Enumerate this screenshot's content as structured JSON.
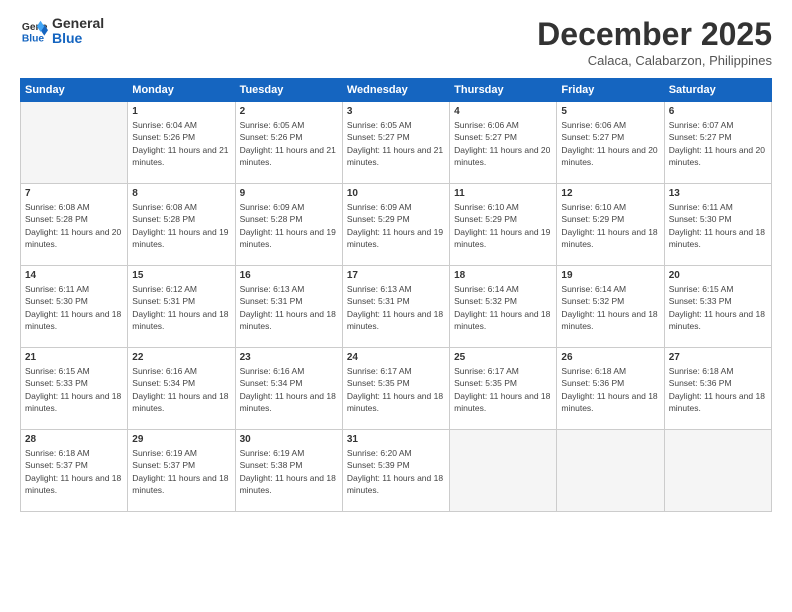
{
  "header": {
    "logo_general": "General",
    "logo_blue": "Blue",
    "month_title": "December 2025",
    "location": "Calaca, Calabarzon, Philippines"
  },
  "weekdays": [
    "Sunday",
    "Monday",
    "Tuesday",
    "Wednesday",
    "Thursday",
    "Friday",
    "Saturday"
  ],
  "weeks": [
    [
      {
        "day": "",
        "sunrise": "",
        "sunset": "",
        "daylight": ""
      },
      {
        "day": "1",
        "sunrise": "Sunrise: 6:04 AM",
        "sunset": "Sunset: 5:26 PM",
        "daylight": "Daylight: 11 hours and 21 minutes."
      },
      {
        "day": "2",
        "sunrise": "Sunrise: 6:05 AM",
        "sunset": "Sunset: 5:26 PM",
        "daylight": "Daylight: 11 hours and 21 minutes."
      },
      {
        "day": "3",
        "sunrise": "Sunrise: 6:05 AM",
        "sunset": "Sunset: 5:27 PM",
        "daylight": "Daylight: 11 hours and 21 minutes."
      },
      {
        "day": "4",
        "sunrise": "Sunrise: 6:06 AM",
        "sunset": "Sunset: 5:27 PM",
        "daylight": "Daylight: 11 hours and 20 minutes."
      },
      {
        "day": "5",
        "sunrise": "Sunrise: 6:06 AM",
        "sunset": "Sunset: 5:27 PM",
        "daylight": "Daylight: 11 hours and 20 minutes."
      },
      {
        "day": "6",
        "sunrise": "Sunrise: 6:07 AM",
        "sunset": "Sunset: 5:27 PM",
        "daylight": "Daylight: 11 hours and 20 minutes."
      }
    ],
    [
      {
        "day": "7",
        "sunrise": "Sunrise: 6:08 AM",
        "sunset": "Sunset: 5:28 PM",
        "daylight": "Daylight: 11 hours and 20 minutes."
      },
      {
        "day": "8",
        "sunrise": "Sunrise: 6:08 AM",
        "sunset": "Sunset: 5:28 PM",
        "daylight": "Daylight: 11 hours and 19 minutes."
      },
      {
        "day": "9",
        "sunrise": "Sunrise: 6:09 AM",
        "sunset": "Sunset: 5:28 PM",
        "daylight": "Daylight: 11 hours and 19 minutes."
      },
      {
        "day": "10",
        "sunrise": "Sunrise: 6:09 AM",
        "sunset": "Sunset: 5:29 PM",
        "daylight": "Daylight: 11 hours and 19 minutes."
      },
      {
        "day": "11",
        "sunrise": "Sunrise: 6:10 AM",
        "sunset": "Sunset: 5:29 PM",
        "daylight": "Daylight: 11 hours and 19 minutes."
      },
      {
        "day": "12",
        "sunrise": "Sunrise: 6:10 AM",
        "sunset": "Sunset: 5:29 PM",
        "daylight": "Daylight: 11 hours and 18 minutes."
      },
      {
        "day": "13",
        "sunrise": "Sunrise: 6:11 AM",
        "sunset": "Sunset: 5:30 PM",
        "daylight": "Daylight: 11 hours and 18 minutes."
      }
    ],
    [
      {
        "day": "14",
        "sunrise": "Sunrise: 6:11 AM",
        "sunset": "Sunset: 5:30 PM",
        "daylight": "Daylight: 11 hours and 18 minutes."
      },
      {
        "day": "15",
        "sunrise": "Sunrise: 6:12 AM",
        "sunset": "Sunset: 5:31 PM",
        "daylight": "Daylight: 11 hours and 18 minutes."
      },
      {
        "day": "16",
        "sunrise": "Sunrise: 6:13 AM",
        "sunset": "Sunset: 5:31 PM",
        "daylight": "Daylight: 11 hours and 18 minutes."
      },
      {
        "day": "17",
        "sunrise": "Sunrise: 6:13 AM",
        "sunset": "Sunset: 5:31 PM",
        "daylight": "Daylight: 11 hours and 18 minutes."
      },
      {
        "day": "18",
        "sunrise": "Sunrise: 6:14 AM",
        "sunset": "Sunset: 5:32 PM",
        "daylight": "Daylight: 11 hours and 18 minutes."
      },
      {
        "day": "19",
        "sunrise": "Sunrise: 6:14 AM",
        "sunset": "Sunset: 5:32 PM",
        "daylight": "Daylight: 11 hours and 18 minutes."
      },
      {
        "day": "20",
        "sunrise": "Sunrise: 6:15 AM",
        "sunset": "Sunset: 5:33 PM",
        "daylight": "Daylight: 11 hours and 18 minutes."
      }
    ],
    [
      {
        "day": "21",
        "sunrise": "Sunrise: 6:15 AM",
        "sunset": "Sunset: 5:33 PM",
        "daylight": "Daylight: 11 hours and 18 minutes."
      },
      {
        "day": "22",
        "sunrise": "Sunrise: 6:16 AM",
        "sunset": "Sunset: 5:34 PM",
        "daylight": "Daylight: 11 hours and 18 minutes."
      },
      {
        "day": "23",
        "sunrise": "Sunrise: 6:16 AM",
        "sunset": "Sunset: 5:34 PM",
        "daylight": "Daylight: 11 hours and 18 minutes."
      },
      {
        "day": "24",
        "sunrise": "Sunrise: 6:17 AM",
        "sunset": "Sunset: 5:35 PM",
        "daylight": "Daylight: 11 hours and 18 minutes."
      },
      {
        "day": "25",
        "sunrise": "Sunrise: 6:17 AM",
        "sunset": "Sunset: 5:35 PM",
        "daylight": "Daylight: 11 hours and 18 minutes."
      },
      {
        "day": "26",
        "sunrise": "Sunrise: 6:18 AM",
        "sunset": "Sunset: 5:36 PM",
        "daylight": "Daylight: 11 hours and 18 minutes."
      },
      {
        "day": "27",
        "sunrise": "Sunrise: 6:18 AM",
        "sunset": "Sunset: 5:36 PM",
        "daylight": "Daylight: 11 hours and 18 minutes."
      }
    ],
    [
      {
        "day": "28",
        "sunrise": "Sunrise: 6:18 AM",
        "sunset": "Sunset: 5:37 PM",
        "daylight": "Daylight: 11 hours and 18 minutes."
      },
      {
        "day": "29",
        "sunrise": "Sunrise: 6:19 AM",
        "sunset": "Sunset: 5:37 PM",
        "daylight": "Daylight: 11 hours and 18 minutes."
      },
      {
        "day": "30",
        "sunrise": "Sunrise: 6:19 AM",
        "sunset": "Sunset: 5:38 PM",
        "daylight": "Daylight: 11 hours and 18 minutes."
      },
      {
        "day": "31",
        "sunrise": "Sunrise: 6:20 AM",
        "sunset": "Sunset: 5:39 PM",
        "daylight": "Daylight: 11 hours and 18 minutes."
      },
      {
        "day": "",
        "sunrise": "",
        "sunset": "",
        "daylight": ""
      },
      {
        "day": "",
        "sunrise": "",
        "sunset": "",
        "daylight": ""
      },
      {
        "day": "",
        "sunrise": "",
        "sunset": "",
        "daylight": ""
      }
    ]
  ]
}
